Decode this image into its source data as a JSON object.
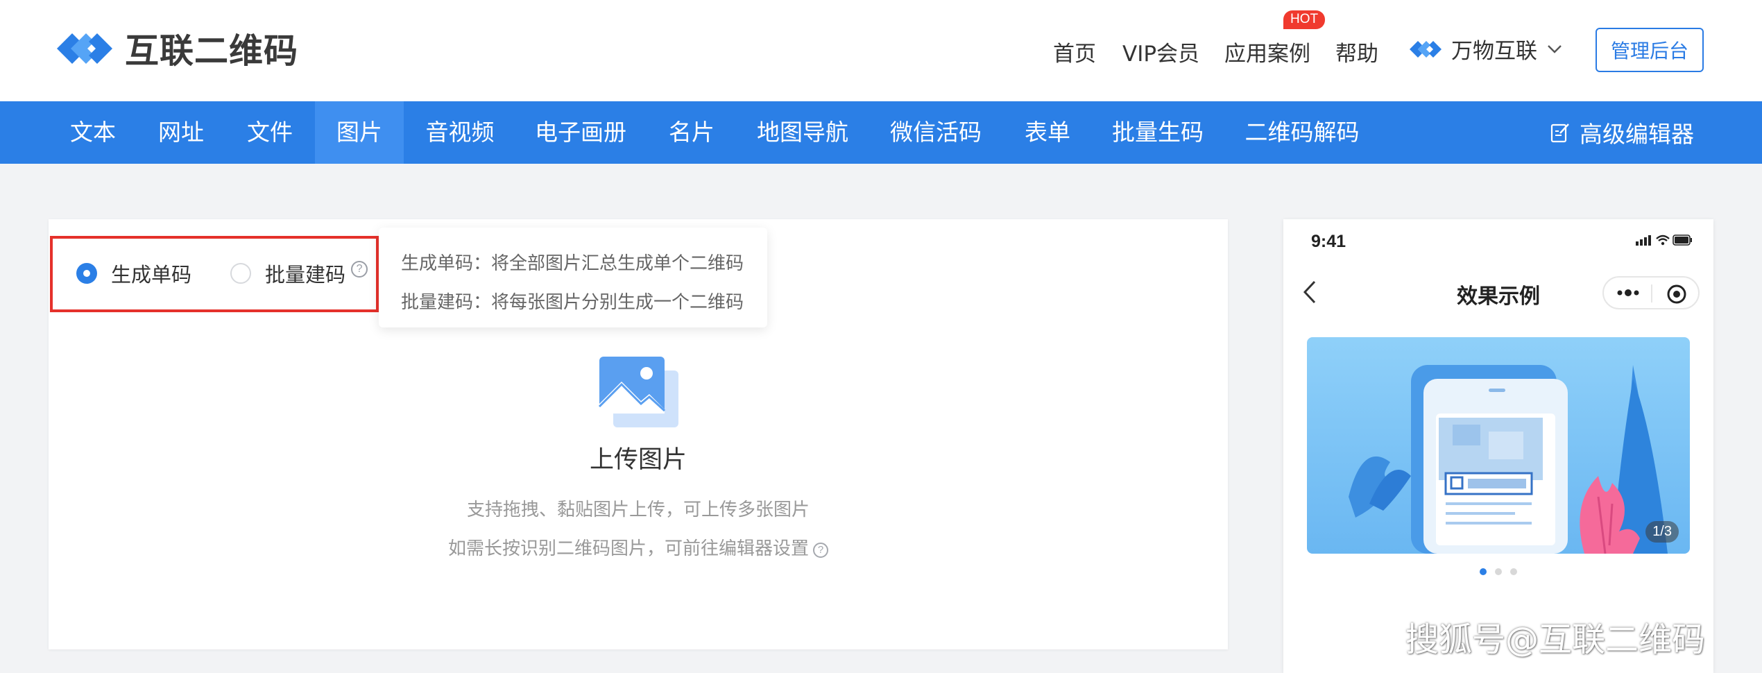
{
  "header": {
    "logo_text": "互联二维码",
    "nav": [
      {
        "label": "首页"
      },
      {
        "label": "VIP会员"
      },
      {
        "label": "应用案例",
        "badge": "HOT"
      },
      {
        "label": "帮助"
      }
    ],
    "brand_menu": "万物互联",
    "admin_button": "管理后台"
  },
  "mainnav": {
    "items": [
      "文本",
      "网址",
      "文件",
      "图片",
      "音视频",
      "电子画册",
      "名片",
      "地图导航",
      "微信活码",
      "表单",
      "批量生码",
      "二维码解码"
    ],
    "active": "图片",
    "editor_link": "高级编辑器"
  },
  "mode": {
    "single_label": "生成单码",
    "batch_label": "批量建码",
    "selected": "生成单码",
    "help_glyph": "?"
  },
  "tooltip": {
    "line1": "生成单码：将全部图片汇总生成单个二维码",
    "line2": "批量建码：将每张图片分别生成一个二维码"
  },
  "upload": {
    "title": "上传图片",
    "tip1": "支持拖拽、黏贴图片上传，可上传多张图片",
    "tip2": "如需长按识别二维码图片，可前往编辑器设置"
  },
  "preview": {
    "time": "9:41",
    "title": "效果示例",
    "page_indicator": "1/3",
    "carousel_current": 1,
    "carousel_total": 3
  },
  "watermark": "搜狐号@互联二维码",
  "colors": {
    "primary": "#2b7fe6",
    "highlight_border": "#e5312b",
    "hot_badge": "#f03a2e"
  }
}
